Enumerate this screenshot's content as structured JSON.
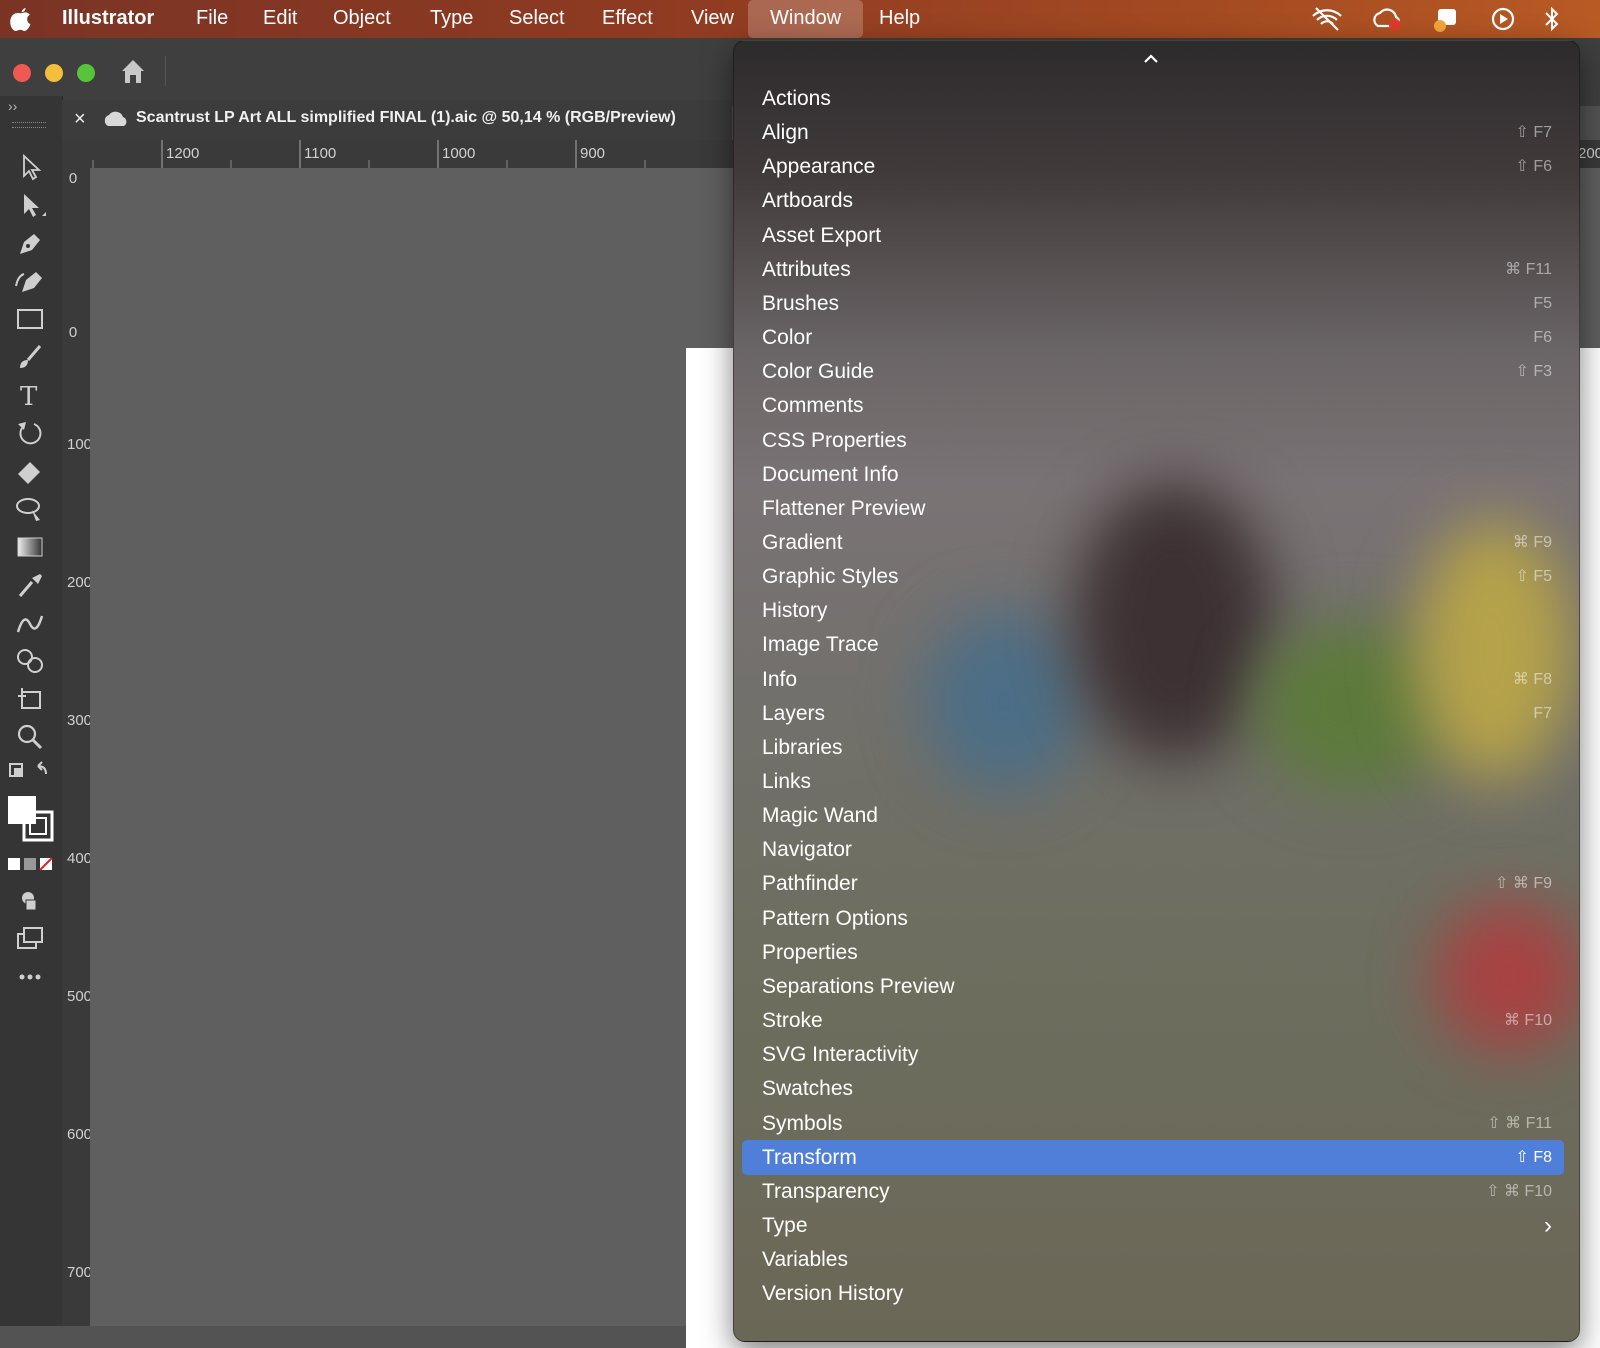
{
  "menubar": {
    "app_name": "Illustrator",
    "items": [
      "File",
      "Edit",
      "Object",
      "Type",
      "Select",
      "Effect",
      "View",
      "Window",
      "Help"
    ],
    "active_item": "Window"
  },
  "document_tab": {
    "close_glyph": "×",
    "title": "Scantrust LP Art ALL simplified FINAL (1).aic @ 50,14 % (RGB/Preview)"
  },
  "panel_collapse_glyph": "››",
  "horizontal_ruler": {
    "ticks": [
      "1200",
      "1100",
      "1000",
      "900"
    ],
    "right_edge_label": "200"
  },
  "vertical_ruler": {
    "ticks": [
      "0",
      "0",
      "100",
      "200",
      "300",
      "400",
      "500",
      "600",
      "700"
    ]
  },
  "window_menu": {
    "items": [
      {
        "label": "Actions",
        "shortcut": ""
      },
      {
        "label": "Align",
        "shortcut": "⇧ F7"
      },
      {
        "label": "Appearance",
        "shortcut": "⇧ F6"
      },
      {
        "label": "Artboards",
        "shortcut": ""
      },
      {
        "label": "Asset Export",
        "shortcut": ""
      },
      {
        "label": "Attributes",
        "shortcut": "⌘ F11"
      },
      {
        "label": "Brushes",
        "shortcut": "F5"
      },
      {
        "label": "Color",
        "shortcut": "F6"
      },
      {
        "label": "Color Guide",
        "shortcut": "⇧ F3"
      },
      {
        "label": "Comments",
        "shortcut": ""
      },
      {
        "label": "CSS Properties",
        "shortcut": ""
      },
      {
        "label": "Document Info",
        "shortcut": ""
      },
      {
        "label": "Flattener Preview",
        "shortcut": ""
      },
      {
        "label": "Gradient",
        "shortcut": "⌘ F9"
      },
      {
        "label": "Graphic Styles",
        "shortcut": "⇧ F5"
      },
      {
        "label": "History",
        "shortcut": ""
      },
      {
        "label": "Image Trace",
        "shortcut": ""
      },
      {
        "label": "Info",
        "shortcut": "⌘ F8"
      },
      {
        "label": "Layers",
        "shortcut": "F7"
      },
      {
        "label": "Libraries",
        "shortcut": ""
      },
      {
        "label": "Links",
        "shortcut": ""
      },
      {
        "label": "Magic Wand",
        "shortcut": ""
      },
      {
        "label": "Navigator",
        "shortcut": ""
      },
      {
        "label": "Pathfinder",
        "shortcut": "⇧ ⌘ F9"
      },
      {
        "label": "Pattern Options",
        "shortcut": ""
      },
      {
        "label": "Properties",
        "shortcut": ""
      },
      {
        "label": "Separations Preview",
        "shortcut": ""
      },
      {
        "label": "Stroke",
        "shortcut": "⌘ F10"
      },
      {
        "label": "SVG Interactivity",
        "shortcut": ""
      },
      {
        "label": "Swatches",
        "shortcut": ""
      },
      {
        "label": "Symbols",
        "shortcut": "⇧ ⌘ F11"
      },
      {
        "label": "Transform",
        "shortcut": "⇧ F8"
      },
      {
        "label": "Transparency",
        "shortcut": "⇧ ⌘ F10"
      },
      {
        "label": "Type",
        "shortcut": "›"
      },
      {
        "label": "Variables",
        "shortcut": ""
      },
      {
        "label": "Version History",
        "shortcut": ""
      }
    ],
    "highlighted_item": "Transform"
  },
  "colors": {
    "highlight": "#4f7fd9",
    "menubar": "#8e3a22"
  }
}
